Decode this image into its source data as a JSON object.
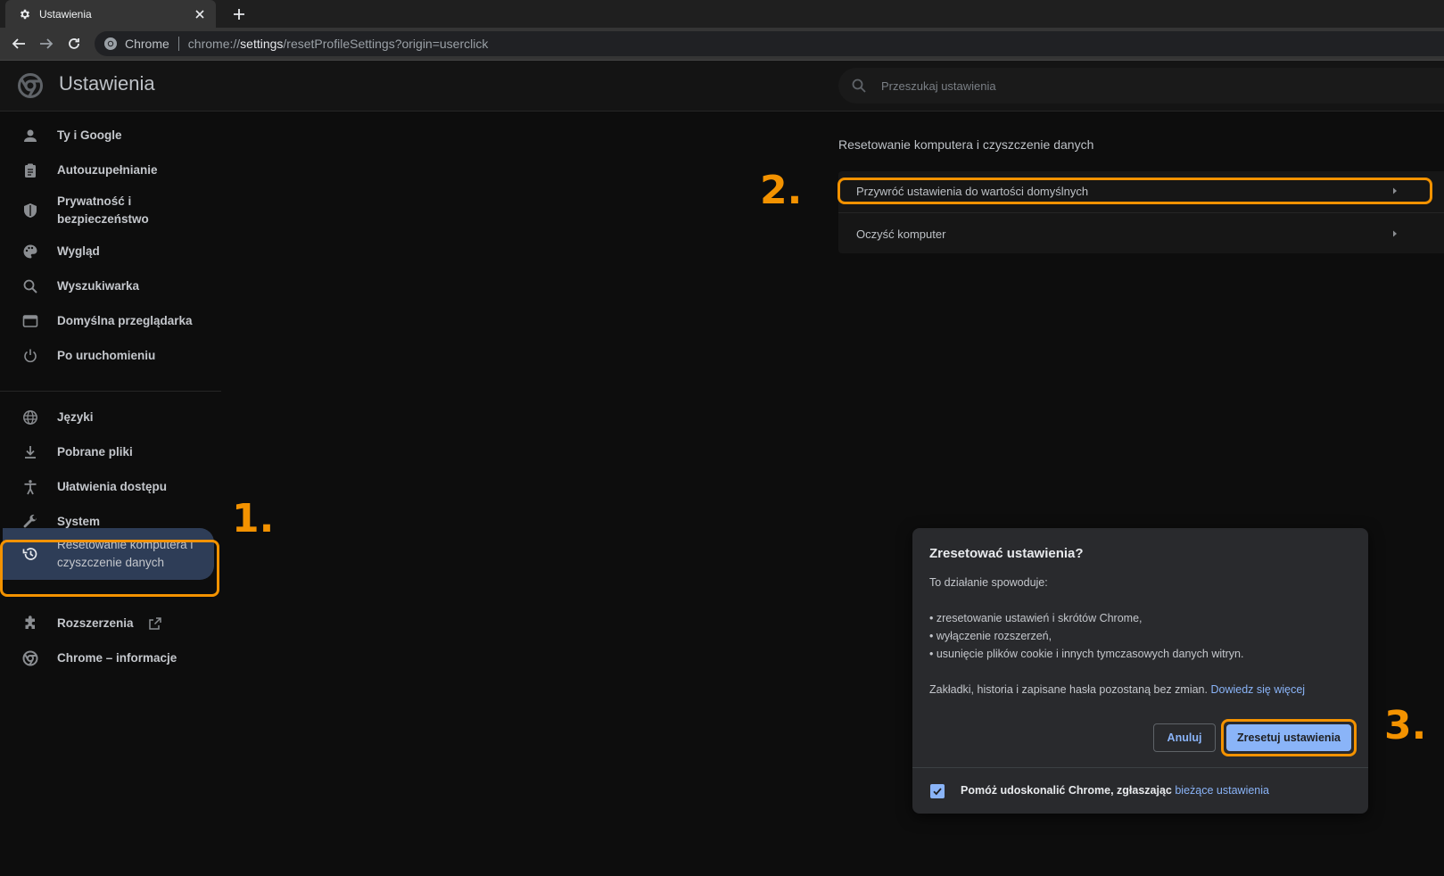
{
  "browser": {
    "tab_title": "Ustawienia",
    "omnibox_chip": "Chrome",
    "url_prefix": "chrome://",
    "url_host": "settings",
    "url_path": "/resetProfileSettings?origin=userclick"
  },
  "header": {
    "title": "Ustawienia",
    "search_placeholder": "Przeszukaj ustawienia"
  },
  "sidebar": {
    "items": [
      {
        "label": "Ty i Google",
        "icon": "person-icon"
      },
      {
        "label": "Autouzupełnianie",
        "icon": "clipboard-icon"
      },
      {
        "label": "Prywatność i bezpieczeństwo",
        "icon": "shield-icon"
      },
      {
        "label": "Wygląd",
        "icon": "palette-icon"
      },
      {
        "label": "Wyszukiwarka",
        "icon": "search-icon"
      },
      {
        "label": "Domyślna przeglądarka",
        "icon": "browser-window-icon"
      },
      {
        "label": "Po uruchomieniu",
        "icon": "power-icon"
      },
      {
        "label": "Języki",
        "icon": "globe-icon"
      },
      {
        "label": "Pobrane pliki",
        "icon": "download-icon"
      },
      {
        "label": "Ułatwienia dostępu",
        "icon": "accessibility-icon"
      },
      {
        "label": "System",
        "icon": "wrench-icon"
      },
      {
        "label": "Resetowanie komputera i czyszczenie danych",
        "icon": "history-icon"
      },
      {
        "label": "Rozszerzenia",
        "icon": "puzzle-icon"
      },
      {
        "label": "Chrome – informacje",
        "icon": "chrome-icon"
      }
    ]
  },
  "main": {
    "section_title": "Resetowanie komputera i czyszczenie danych",
    "rows": [
      {
        "label": "Przywróć ustawienia do wartości domyślnych"
      },
      {
        "label": "Oczyść komputer"
      }
    ]
  },
  "dialog": {
    "title": "Zresetować ustawienia?",
    "intro": "To działanie spowoduje:",
    "bullets": [
      "• zresetowanie ustawień i skrótów Chrome,",
      "• wyłączenie rozszerzeń,",
      "• usunięcie plików cookie i innych tymczasowych danych witryn."
    ],
    "note": "Zakładki, historia i zapisane hasła pozostaną bez zmian.",
    "learn_more": "Dowiedz się więcej",
    "cancel_label": "Anuluj",
    "reset_label": "Zresetuj ustawienia",
    "footer_label": "Pomóż udoskonalić Chrome, zgłaszając",
    "footer_link": "bieżące ustawienia",
    "footer_checked": true
  },
  "annotations": {
    "step1": "1.",
    "step2": "2.",
    "step3": "3.",
    "color": "#f39200"
  },
  "colors": {
    "accent": "#8ab4f8",
    "active_nav": "#2e3d57",
    "highlight": "#f39200"
  }
}
